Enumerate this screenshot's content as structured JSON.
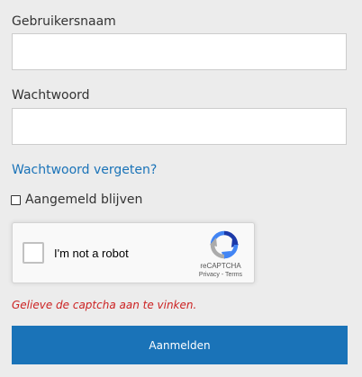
{
  "form": {
    "username_label": "Gebruikersnaam",
    "username_value": "",
    "password_label": "Wachtwoord",
    "password_value": "",
    "forgot_password_link": "Wachtwoord vergeten?",
    "remember_me_label": "Aangemeld blijven",
    "remember_me_checked": false,
    "error_message": "Gelieve de captcha aan te vinken.",
    "submit_label": "Aanmelden"
  },
  "recaptcha": {
    "checkbox_label": "I'm not a robot",
    "checked": false,
    "brand": "reCAPTCHA",
    "privacy_link": "Privacy",
    "separator": "-",
    "terms_link": "Terms",
    "icon": "recaptcha-logo-icon"
  },
  "colors": {
    "background": "#ececec",
    "accent": "#1a73b8",
    "error": "#cc2222",
    "text": "#333333"
  }
}
